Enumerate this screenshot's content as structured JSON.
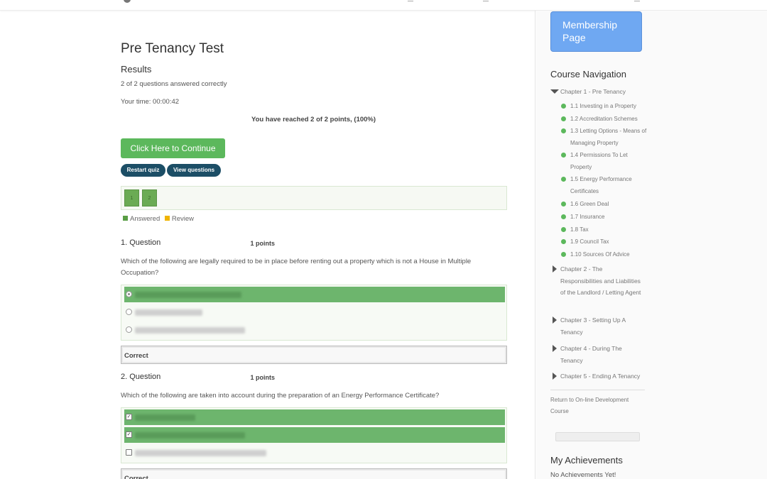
{
  "quiz": {
    "title": "Pre Tenancy Test",
    "results_heading": "Results",
    "answered_summary": "2 of 2 questions answered correctly",
    "your_time": "Your time: 00:00:42",
    "points_reached": "You have reached 2 of 2 points, (100%)",
    "continue_label": "Click Here to Continue",
    "restart_label": "Restart quiz",
    "view_questions_label": "View questions",
    "pages": [
      "1",
      "2"
    ],
    "legend": {
      "answered": "Answered",
      "review": "Review",
      "answered_color": "#5cb85c",
      "review_color": "#f0ad4e"
    }
  },
  "questions": [
    {
      "heading": "1. Question",
      "points": "1 points",
      "text": "Which of the following are legally required to be in place before renting out a property which is not a House in Multiple Occupation?",
      "answer_type": "radio",
      "answers": [
        {
          "state": "correct",
          "selected": true
        },
        {
          "state": "neutral",
          "selected": false
        },
        {
          "state": "neutral",
          "selected": false
        }
      ],
      "result": "Correct"
    },
    {
      "heading": "2. Question",
      "points": "1 points",
      "text": "Which of the following are taken into account during the preparation of an Energy Performance Certificate?",
      "answer_type": "checkbox",
      "answers": [
        {
          "state": "correct",
          "selected": true
        },
        {
          "state": "correct",
          "selected": true
        },
        {
          "state": "neutral",
          "selected": false
        }
      ],
      "result": "Correct"
    }
  ],
  "sidebar": {
    "membership_label": "Membership Page",
    "nav_title": "Course Navigation",
    "chapters": [
      {
        "label": "Chapter 1 - Pre Tenancy",
        "expanded": true,
        "lessons": [
          "1.1 Investing in a Property",
          "1.2 Accreditation Schemes",
          "1.3 Letting Options - Means of Managing Property",
          "1.4 Permissions To Let Property",
          "1.5 Energy Performance Certificates",
          "1.6 Green Deal",
          "1.7 Insurance",
          "1.8 Tax",
          "1.9 Council Tax",
          "1.10 Sources Of Advice"
        ]
      },
      {
        "label": "Chapter 2 - The Responsibilities and Liabilities of the Landlord / Letting Agent",
        "expanded": false
      },
      {
        "label": "Chapter 3 - Setting Up A Tenancy",
        "expanded": false
      },
      {
        "label": "Chapter 4 - During The Tenancy",
        "expanded": false
      },
      {
        "label": "Chapter 5 - Ending A Tenancy",
        "expanded": false
      }
    ],
    "return_link": "Return to On-line Development Course",
    "achievements_title": "My Achievements",
    "achievements_text": "No Achievements Yet!"
  },
  "icons": {
    "expanded": "triangle-down-icon",
    "collapsed": "triangle-right-icon",
    "lesson_complete": "green-dot-icon"
  }
}
